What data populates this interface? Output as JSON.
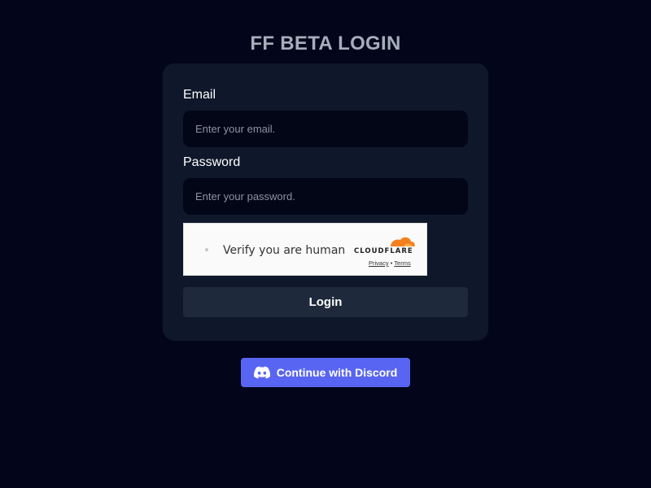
{
  "page": {
    "title": "FF BETA LOGIN"
  },
  "form": {
    "email_label": "Email",
    "email_placeholder": "Enter your email.",
    "email_value": "",
    "password_label": "Password",
    "password_placeholder": "Enter your password.",
    "password_value": "",
    "login_label": "Login"
  },
  "captcha": {
    "text": "Verify you are human",
    "brand": "CLOUDFLARE",
    "privacy_label": "Privacy",
    "separator": "•",
    "terms_label": "Terms",
    "brand_color": "#f38020"
  },
  "discord": {
    "label": "Continue with Discord",
    "color": "#5865f2"
  },
  "icons": {
    "discord": "discord-icon",
    "cloudflare": "cloudflare-cloud-icon"
  }
}
